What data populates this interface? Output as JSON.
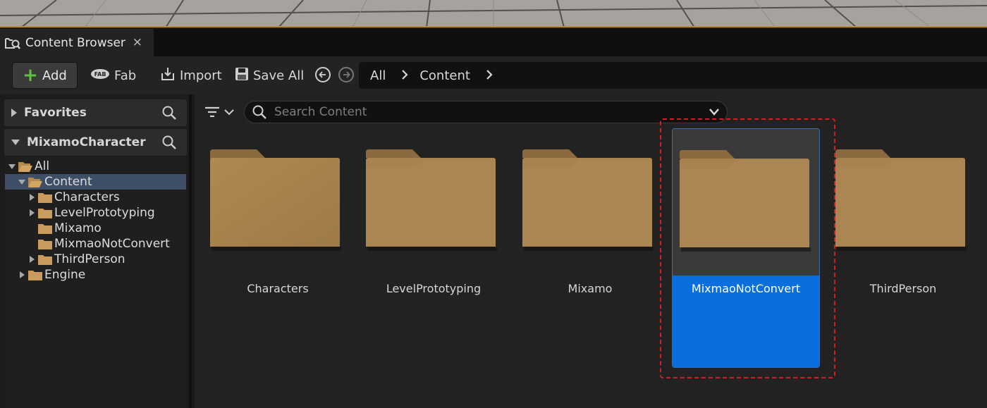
{
  "tab": {
    "title": "Content Browser",
    "close": "×"
  },
  "toolbar": {
    "add_label": "Add",
    "fab_label": "Fab",
    "import_label": "Import",
    "save_all_label": "Save All"
  },
  "breadcrumb": {
    "items": [
      "All",
      "Content"
    ]
  },
  "left_panel": {
    "favorites_label": "Favorites",
    "project_label": "MixamoCharacter",
    "tree": [
      {
        "label": "All",
        "depth": 0,
        "expanded": true
      },
      {
        "label": "Content",
        "depth": 1,
        "expanded": true,
        "selected": true
      },
      {
        "label": "Characters",
        "depth": 2,
        "has_children": true
      },
      {
        "label": "LevelPrototyping",
        "depth": 2,
        "has_children": true
      },
      {
        "label": "Mixamo",
        "depth": 2,
        "has_children": false
      },
      {
        "label": "MixmaoNotConvert",
        "depth": 2,
        "has_children": false
      },
      {
        "label": "ThirdPerson",
        "depth": 2,
        "has_children": true
      },
      {
        "label": "Engine",
        "depth": 1,
        "has_children": true
      }
    ]
  },
  "search": {
    "placeholder": "Search Content"
  },
  "folders": [
    {
      "name": "Characters"
    },
    {
      "name": "LevelPrototyping"
    },
    {
      "name": "Mixamo"
    },
    {
      "name": "MixmaoNotConvert",
      "selected": true
    },
    {
      "name": "ThirdPerson"
    }
  ],
  "colors": {
    "folder": "#a8834f",
    "selection_blue": "#0a6fde",
    "highlight_dashed": "#d21f1f",
    "tree_selected": "#3d4e66",
    "add_plus": "#5cc23e"
  }
}
